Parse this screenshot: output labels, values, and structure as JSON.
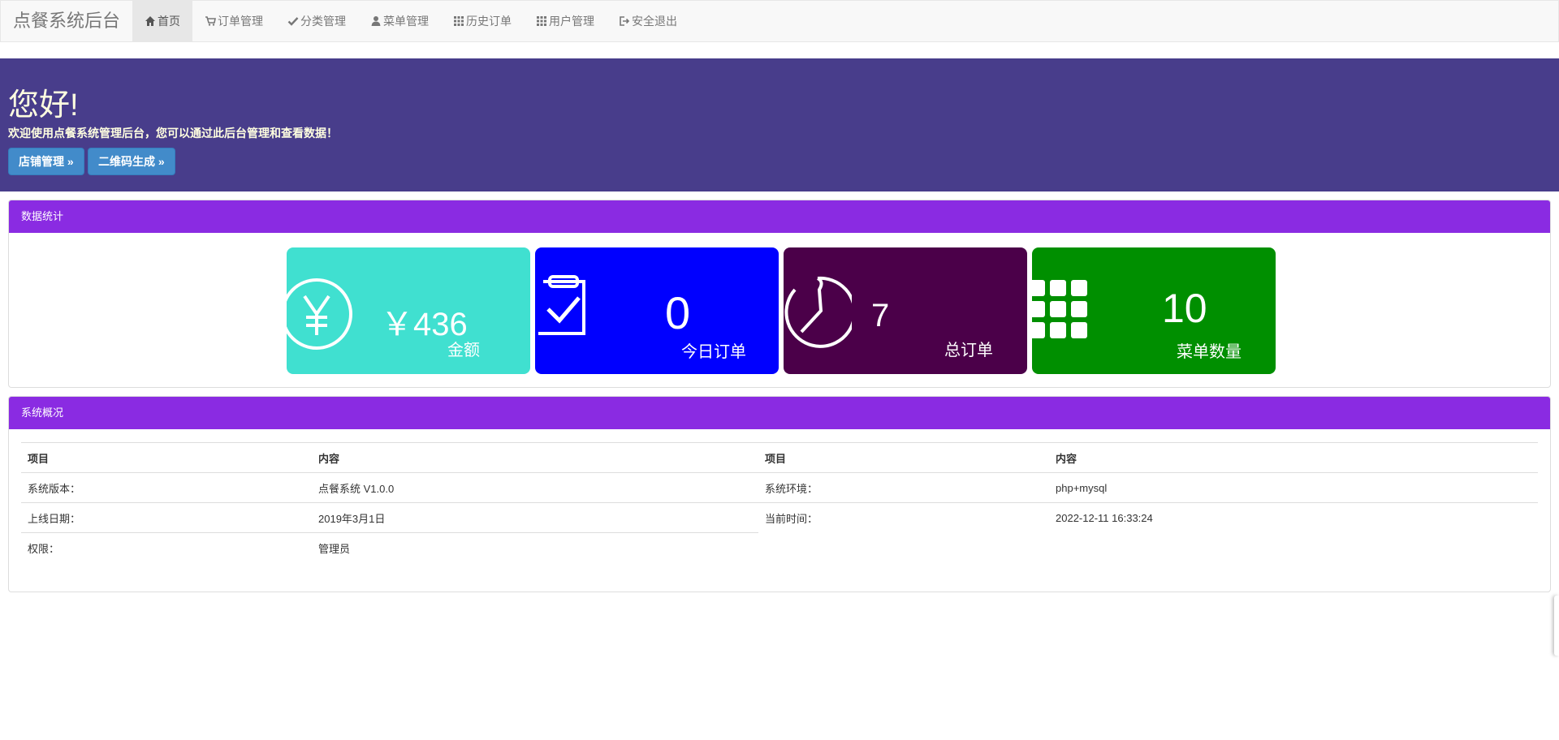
{
  "navbar": {
    "brand": "点餐系统后台",
    "items": [
      {
        "label": "首页",
        "icon": "home-icon",
        "active": true
      },
      {
        "label": "订单管理",
        "icon": "cart-icon"
      },
      {
        "label": "分类管理",
        "icon": "check-icon"
      },
      {
        "label": "菜单管理",
        "icon": "user-icon"
      },
      {
        "label": "历史订单",
        "icon": "grid-icon"
      },
      {
        "label": "用户管理",
        "icon": "grid-icon"
      },
      {
        "label": "安全退出",
        "icon": "logout-icon"
      }
    ]
  },
  "hero": {
    "title": "您好!",
    "description": "欢迎使用点餐系统管理后台，您可以通过此后台管理和查看数据！",
    "buttons": [
      "店铺管理 »",
      "二维码生成 »"
    ]
  },
  "stats": {
    "heading": "数据统计",
    "cards": [
      {
        "value": "￥436",
        "label": "金额",
        "color": "#40E0D0",
        "icon": "yen-icon"
      },
      {
        "value": "0",
        "label": "今日订单",
        "color": "#0000FF",
        "icon": "clipboard-check-icon"
      },
      {
        "value": "7",
        "label": "总订单",
        "color": "#4B0049",
        "icon": "timer-icon"
      },
      {
        "value": "10",
        "label": "菜单数量",
        "color": "#008F00",
        "icon": "grid-icon"
      }
    ]
  },
  "overview": {
    "heading": "系统概况",
    "left": {
      "headers": [
        "项目",
        "内容"
      ],
      "rows": [
        [
          "系统版本：",
          "点餐系统 V1.0.0"
        ],
        [
          "上线日期：",
          "2019年3月1日"
        ],
        [
          "权限：",
          "管理员"
        ]
      ]
    },
    "right": {
      "headers": [
        "项目",
        "内容"
      ],
      "rows": [
        [
          "系统环境：",
          "php+mysql"
        ],
        [
          "当前时间：",
          "2022-12-11 16:33:24"
        ]
      ]
    }
  }
}
